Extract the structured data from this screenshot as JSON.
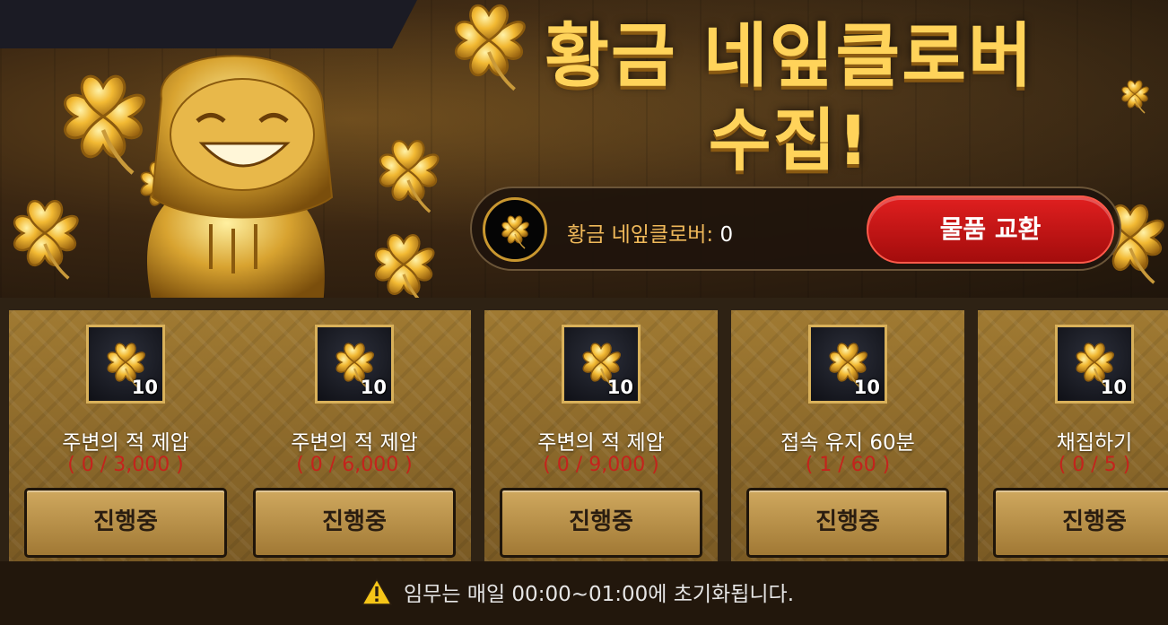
{
  "banner": {
    "title_line1": "황금 네잎클로버",
    "title_line2": "수집!"
  },
  "counter": {
    "label": "황금 네잎클로버:",
    "count": "0",
    "icon": "golden-clover-icon"
  },
  "exchange_button": {
    "label": "물품 교환"
  },
  "missions": [
    {
      "title": "주변의 적 제압",
      "progress": "( 0 / 3,000 )",
      "reward_qty": "10",
      "button": "진행중"
    },
    {
      "title": "주변의 적 제압",
      "progress": "( 0 / 6,000 )",
      "reward_qty": "10",
      "button": "진행중"
    },
    {
      "title": "주변의 적 제압",
      "progress": "( 0 / 9,000 )",
      "reward_qty": "10",
      "button": "진행중"
    },
    {
      "title": "접속 유지 60분",
      "progress": "( 1 / 60 )",
      "reward_qty": "10",
      "button": "진행중"
    },
    {
      "title": "채집하기",
      "progress": "( 0 / 5 )",
      "reward_qty": "10",
      "button": "진행중"
    }
  ],
  "notice": {
    "icon": "warning-icon",
    "text": "임무는 매일 00:00~01:00에 초기화됩니다."
  },
  "colors": {
    "title_gold": "#ffd35a",
    "exchange_red": "#d01818",
    "progress_red": "#c4231c",
    "card_gold": "#a07a32"
  }
}
